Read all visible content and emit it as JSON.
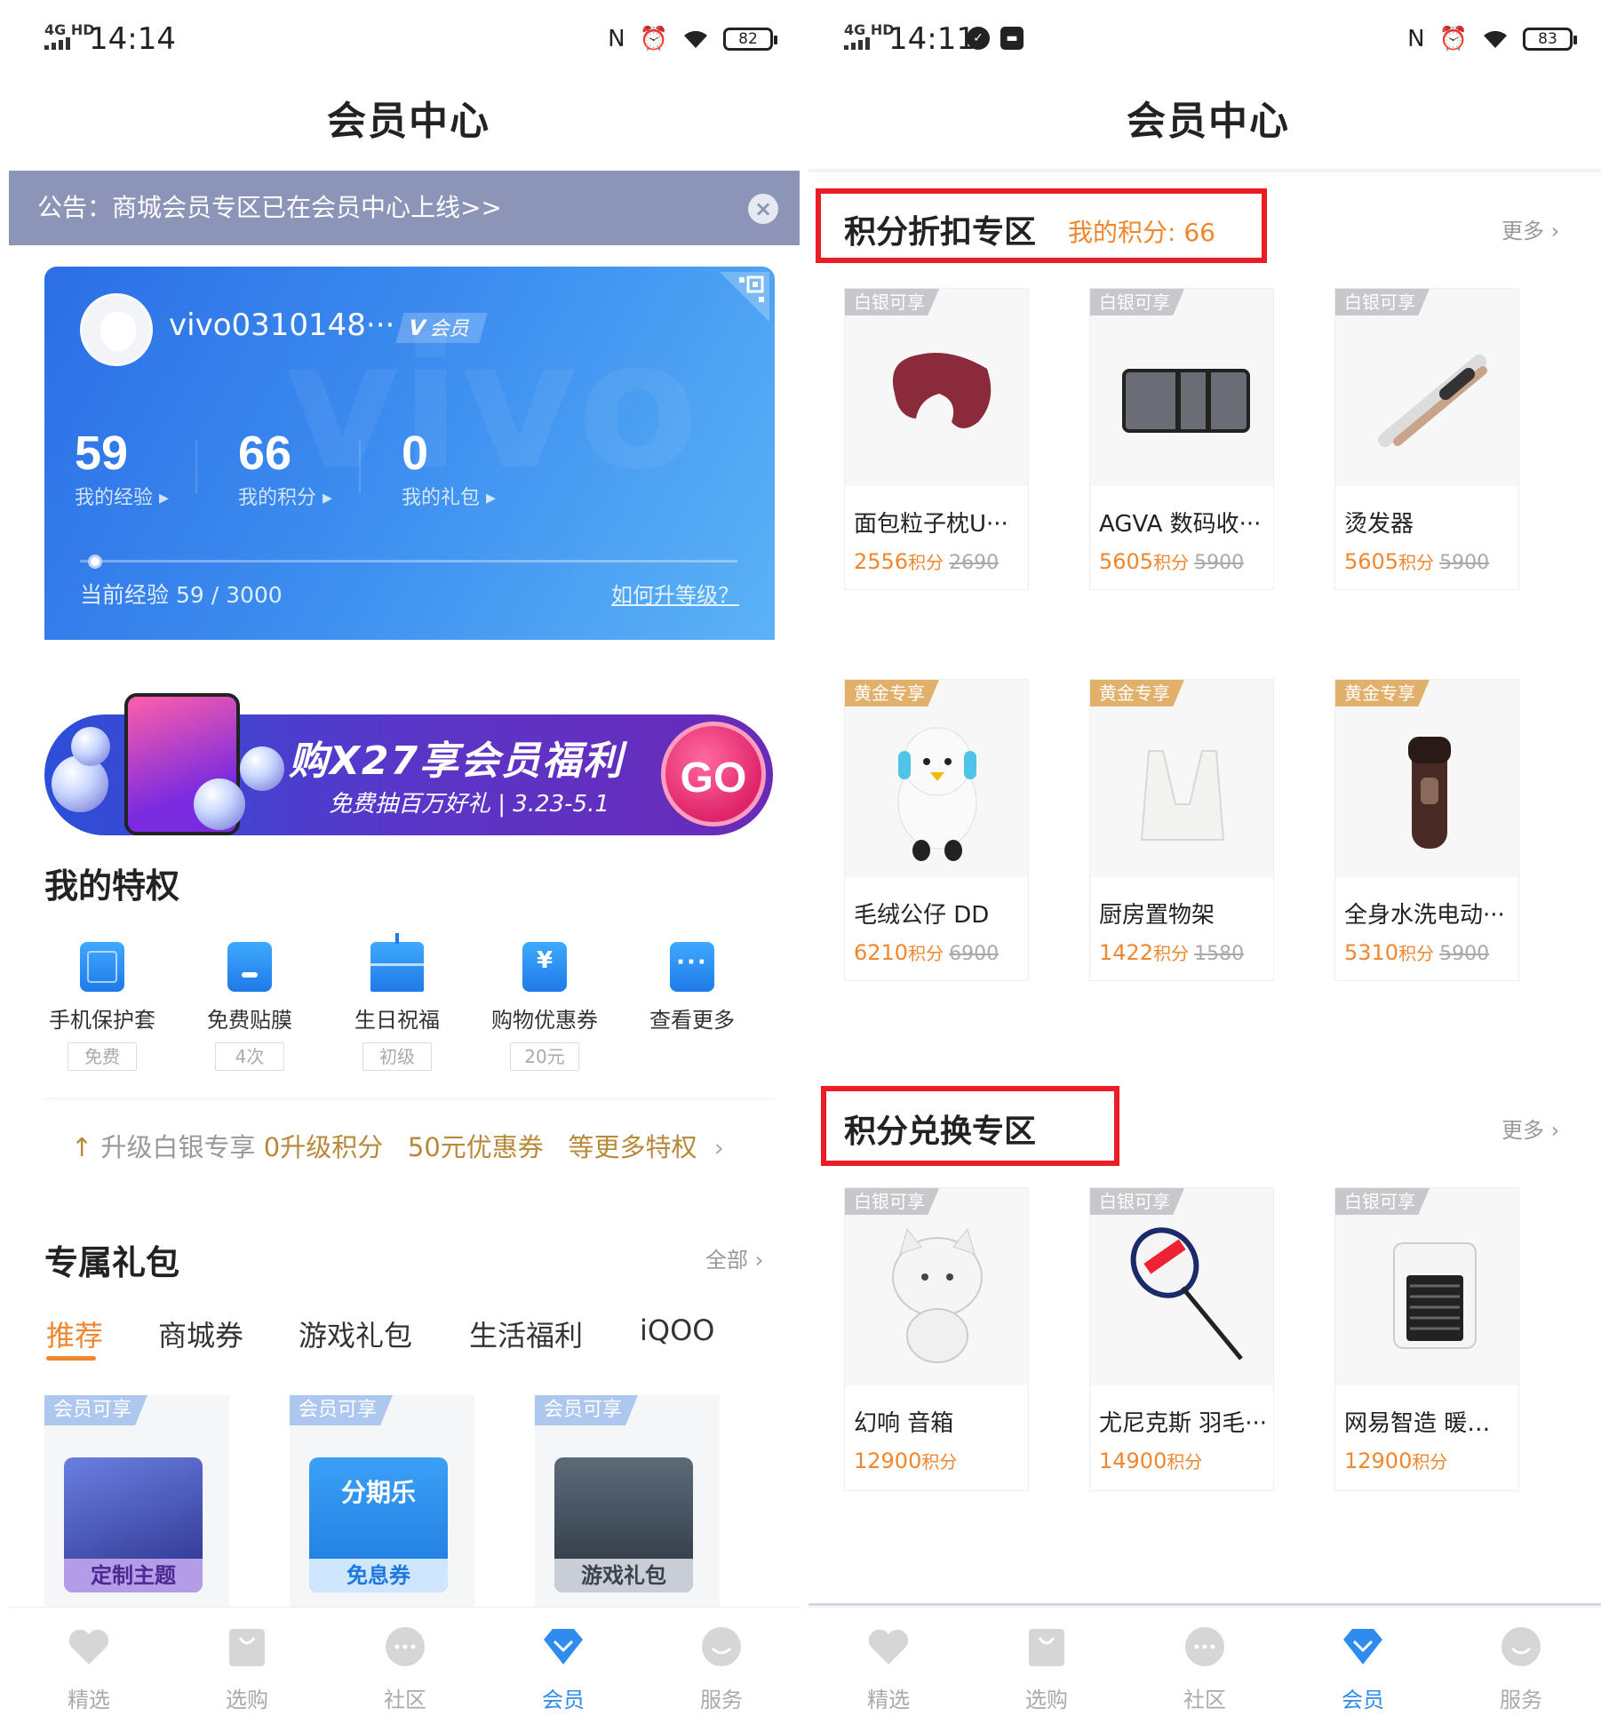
{
  "left": {
    "status": {
      "network": "4G HD",
      "time": "14:14",
      "battery": "82"
    },
    "title": "会员中心",
    "notice": {
      "text": "公告：商城会员专区已在会员中心上线>>",
      "close": "×"
    },
    "card": {
      "username": "vivo0310148···",
      "badge_v": "V",
      "badge_text": "会员",
      "watermark": "vivo",
      "stats": [
        {
          "value": "59",
          "label": "我的经验 ▸"
        },
        {
          "value": "66",
          "label": "我的积分 ▸"
        },
        {
          "value": "0",
          "label": "我的礼包 ▸"
        }
      ],
      "experience_progress": 0.0197,
      "exp_text": "当前经验 59 / 3000",
      "how_upgrade": "如何升等级？"
    },
    "banner": {
      "headline": "购X27享会员福利",
      "sub": "免费抽百万好礼 | 3.23-5.1",
      "go": "GO"
    },
    "privileges": {
      "title": "我的特权",
      "items": [
        {
          "label": "手机保护套",
          "tag": "免费",
          "icon": "phone-case-icon"
        },
        {
          "label": "免费贴膜",
          "tag": "4次",
          "icon": "screen-film-icon"
        },
        {
          "label": "生日祝福",
          "tag": "初级",
          "icon": "birthday-cake-icon"
        },
        {
          "label": "购物优惠券",
          "tag": "20元",
          "icon": "coupon-icon"
        },
        {
          "label": "查看更多",
          "tag": "",
          "icon": "more-dots-icon"
        }
      ],
      "upgrade": {
        "prefix": "升级白银专享",
        "points": "0升级积分",
        "coupon": "50元优惠券",
        "more": "等更多特权",
        "arrow": "›"
      }
    },
    "gifts": {
      "title": "专属礼包",
      "all": "全部 ›",
      "tabs": [
        "推荐",
        "商城券",
        "游戏礼包",
        "生活福利",
        "iQOO"
      ],
      "cards": [
        {
          "tag": "会员可享",
          "label": "定制主题"
        },
        {
          "tag": "会员可享",
          "label": "免息券",
          "logo": "分期乐"
        },
        {
          "tag": "会员可享",
          "label": "游戏礼包"
        }
      ]
    },
    "nav": [
      {
        "label": "精选",
        "icon": "heart-icon"
      },
      {
        "label": "选购",
        "icon": "shopping-bag-icon"
      },
      {
        "label": "社区",
        "icon": "chat-bubble-icon"
      },
      {
        "label": "会员",
        "icon": "diamond-icon"
      },
      {
        "label": "服务",
        "icon": "smile-icon"
      }
    ]
  },
  "right": {
    "status": {
      "network": "4G HD",
      "time": "14:11",
      "battery": "83"
    },
    "title": "会员中心",
    "discount_zone": {
      "title": "积分折扣专区",
      "points": "我的积分: 66",
      "more": "更多 ›",
      "products": [
        {
          "tag": "白银可享",
          "name": "面包粒子枕U···",
          "price": "2556",
          "unit": "积分",
          "original": "2690"
        },
        {
          "tag": "白银可享",
          "name": "AGVA 数码收···",
          "price": "5605",
          "unit": "积分",
          "original": "5900"
        },
        {
          "tag": "白银可享",
          "name": "烫发器",
          "price": "5605",
          "unit": "积分",
          "original": "5900"
        },
        {
          "tag": "黄金专享",
          "name": "毛绒公仔 DD",
          "price": "6210",
          "unit": "积分",
          "original": "6900"
        },
        {
          "tag": "黄金专享",
          "name": "厨房置物架",
          "price": "1422",
          "unit": "积分",
          "original": "1580"
        },
        {
          "tag": "黄金专享",
          "name": "全身水洗电动···",
          "price": "5310",
          "unit": "积分",
          "original": "5900"
        }
      ]
    },
    "exchange_zone": {
      "title": "积分兑换专区",
      "more": "更多 ›",
      "products": [
        {
          "tag": "白银可享",
          "name": "幻响 音箱",
          "price": "12900",
          "unit": "积分"
        },
        {
          "tag": "白银可享",
          "name": "尤尼克斯 羽毛···",
          "price": "14900",
          "unit": "积分"
        },
        {
          "tag": "白银可享",
          "name": "网易智造 暖风机",
          "price": "12900",
          "unit": "积分"
        }
      ]
    },
    "nav": [
      {
        "label": "精选",
        "icon": "heart-icon"
      },
      {
        "label": "选购",
        "icon": "shopping-bag-icon"
      },
      {
        "label": "社区",
        "icon": "chat-bubble-icon"
      },
      {
        "label": "会员",
        "icon": "diamond-icon"
      },
      {
        "label": "服务",
        "icon": "smile-icon"
      }
    ]
  }
}
